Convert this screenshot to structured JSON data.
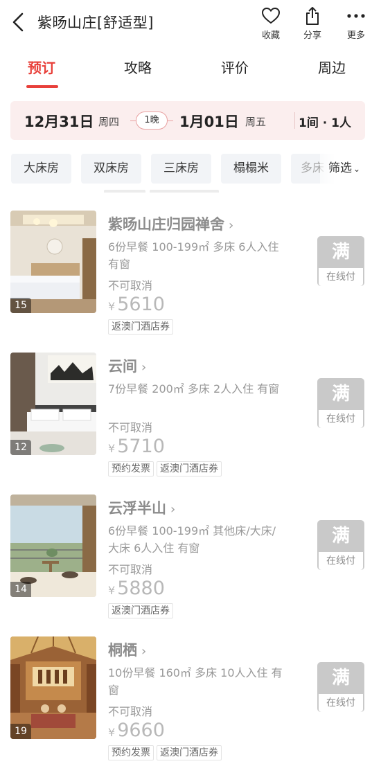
{
  "header": {
    "title": "紫旸山庄[舒适型]",
    "actions": [
      {
        "icon": "heart-icon",
        "label": "收藏"
      },
      {
        "icon": "share-icon",
        "label": "分享"
      },
      {
        "icon": "more-icon",
        "label": "更多"
      }
    ]
  },
  "tabs": [
    {
      "label": "预订",
      "active": true
    },
    {
      "label": "攻略",
      "active": false
    },
    {
      "label": "评价",
      "active": false
    },
    {
      "label": "周边",
      "active": false
    }
  ],
  "dates": {
    "checkin_date": "12月31日",
    "checkin_weekday": "周四",
    "nights": "1晚",
    "checkout_date": "1月01日",
    "checkout_weekday": "周五",
    "rooms_guests": "1间 · 1人"
  },
  "filters": {
    "chips": [
      "大床房",
      "双床房",
      "三床房",
      "榻榻米",
      "多床"
    ],
    "filter_label": "筛选"
  },
  "rooms": [
    {
      "name": "紫旸山庄归园禅舍",
      "photo_count": "15",
      "desc": "6份早餐 100-199㎡ 多床 6人入住 有窗",
      "cancel": "不可取消",
      "currency": "¥",
      "price": "5610",
      "tags": [
        "返澳门酒店券"
      ],
      "status": "满",
      "pay": "在线付"
    },
    {
      "name": "云间",
      "photo_count": "12",
      "desc": "7份早餐 200㎡ 多床 2人入住 有窗",
      "cancel": "不可取消",
      "currency": "¥",
      "price": "5710",
      "tags": [
        "预约发票",
        "返澳门酒店券"
      ],
      "status": "满",
      "pay": "在线付"
    },
    {
      "name": "云浮半山",
      "photo_count": "14",
      "desc": "6份早餐 100-199㎡ 其他床/大床/大床 6人入住 有窗",
      "cancel": "不可取消",
      "currency": "¥",
      "price": "5880",
      "tags": [
        "返澳门酒店券"
      ],
      "status": "满",
      "pay": "在线付"
    },
    {
      "name": "桐栖",
      "photo_count": "19",
      "desc": "10份早餐 160㎡ 多床 10人入住 有窗",
      "cancel": "不可取消",
      "currency": "¥",
      "price": "9660",
      "tags": [
        "预约发票",
        "返澳门酒店券"
      ],
      "status": "满",
      "pay": "在线付"
    }
  ]
}
